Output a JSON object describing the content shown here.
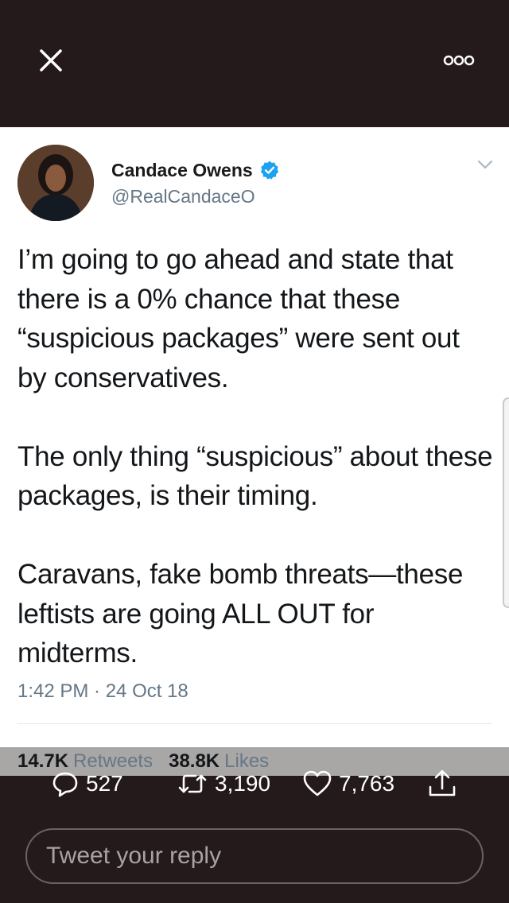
{
  "header": {
    "close_icon": "close-icon",
    "more_icon": "more-options-icon"
  },
  "tweet": {
    "author_name": "Candace Owens",
    "handle": "@RealCandaceO",
    "verified": true,
    "paragraphs": [
      "I’m going to go ahead and state that there is a 0% chance that these “suspicious packages” were sent out by conservatives.",
      "The only thing “suspicious” about these packages, is their timing.",
      "Caravans, fake bomb threats—these leftists are going ALL OUT for midterms."
    ],
    "timestamp": "1:42 PM · 24 Oct 18"
  },
  "stats": {
    "retweets_count": "14.7K",
    "retweets_label": "Retweets",
    "likes_count": "38.8K",
    "likes_label": "Likes"
  },
  "actions": {
    "reply_count": "527",
    "retweet_count": "3,190",
    "like_count": "7,763"
  },
  "reply": {
    "placeholder": "Tweet your reply"
  },
  "colors": {
    "background": "#241a1b",
    "card": "#ffffff",
    "verified": "#1da1f2",
    "muted": "#657786"
  }
}
